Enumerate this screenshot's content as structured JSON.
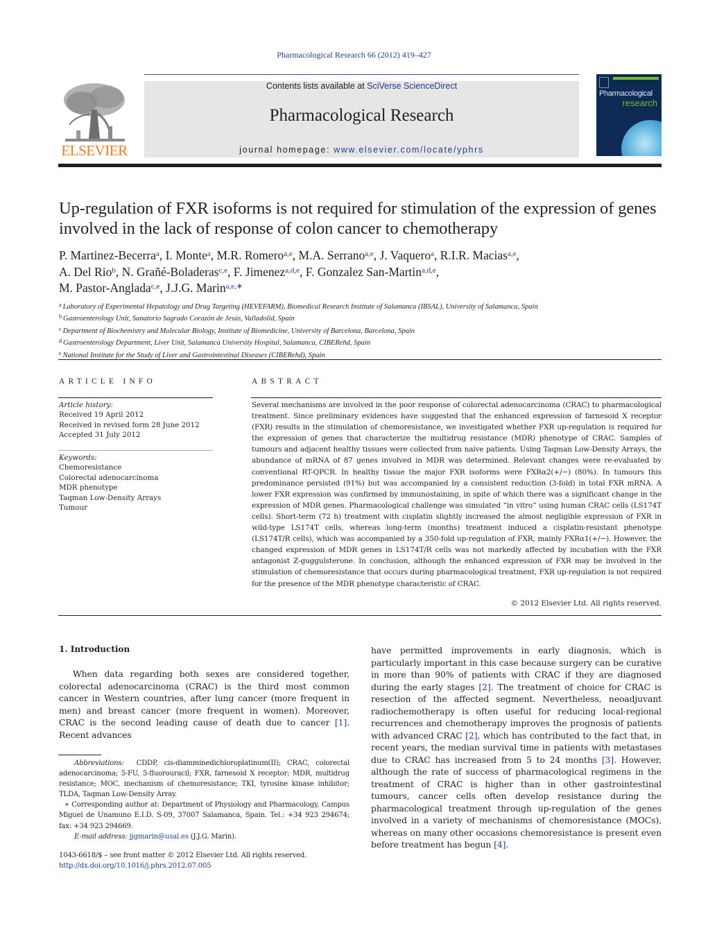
{
  "header": {
    "journal_reference": "Pharmacological Research 66 (2012) 419–427",
    "contents_prefix": "Contents lists available at ",
    "contents_link": "SciVerse ScienceDirect",
    "journal_title": "Pharmacological Research",
    "homepage_prefix": "journal homepage: ",
    "homepage_link": "www.elsevier.com/locate/yphrs",
    "publisher_logo_text": "ELSEVIER",
    "cover_title_line1": "Pharmacological",
    "cover_title_line2": "research",
    "colors": {
      "link": "#1f3f8f",
      "publisher_orange": "#f07c1e",
      "cover_green": "#7ab929",
      "cover_navy": "#0d2a55"
    }
  },
  "article": {
    "title": "Up-regulation of FXR isoforms is not required for stimulation of the expression of genes involved in the lack of response of colon cancer to chemotherapy",
    "authors": [
      {
        "name": "P. Martinez-Becerra",
        "aff": "a"
      },
      {
        "name": "I. Monte",
        "aff": "a"
      },
      {
        "name": "M.R. Romero",
        "aff": "a,e"
      },
      {
        "name": "M.A. Serrano",
        "aff": "a,e"
      },
      {
        "name": "J. Vaquero",
        "aff": "a"
      },
      {
        "name": "R.I.R. Macias",
        "aff": "a,e"
      },
      {
        "name": "A. Del Rio",
        "aff": "b"
      },
      {
        "name": "N. Grañé-Boladeras",
        "aff": "c,e"
      },
      {
        "name": "F. Jimenez",
        "aff": "a,d,e"
      },
      {
        "name": "F. Gonzalez San-Martin",
        "aff": "a,d,e"
      },
      {
        "name": "M. Pastor-Anglada",
        "aff": "c,e"
      },
      {
        "name": "J.J.G. Marin",
        "aff": "a,e,∗"
      }
    ],
    "affiliations": [
      {
        "key": "a",
        "text": "Laboratory of Experimental Hepatology and Drug Targeting (HEVEFARM), Biomedical Research Institute of Salamanca (IBSAL), University of Salamanca, Spain"
      },
      {
        "key": "b",
        "text": "Gastroenterology Unit, Sanatorio Sagrado Corazón de Jesús, Valladolid, Spain"
      },
      {
        "key": "c",
        "text": "Department of Biochemistry and Molecular Biology, Institute of Biomedicine, University of Barcelona, Barcelona, Spain"
      },
      {
        "key": "d",
        "text": "Gastroenterology Department, Liver Unit, Salamanca University Hospital, Salamanca, CIBERehd, Spain"
      },
      {
        "key": "e",
        "text": "National Institute for the Study of Liver and Gastrointestinal Diseases (CIBERehd), Spain"
      }
    ]
  },
  "article_info": {
    "heading": "ARTICLE INFO",
    "history_label": "Article history:",
    "history": [
      "Received 19 April 2012",
      "Received in revised form 28 June 2012",
      "Accepted 31 July 2012"
    ],
    "keywords_label": "Keywords:",
    "keywords": [
      "Chemoresistance",
      "Colorectal adenocarcinoma",
      "MDR phenotype",
      "Taqman Low-Density Arrays",
      "Tumour"
    ]
  },
  "abstract": {
    "heading": "ABSTRACT",
    "text": "Several mechanisms are involved in the poor response of colorectal adenocarcinoma (CRAC) to pharmacological treatment. Since preliminary evidences have suggested that the enhanced expression of farnesoid X receptor (FXR) results in the stimulation of chemoresistance, we investigated whether FXR up-regulation is required for the expression of genes that characterize the multidrug resistance (MDR) phenotype of CRAC. Samples of tumours and adjacent healthy tissues were collected from naive patients. Using Taqman Low-Density Arrays, the abundance of mRNA of 87 genes involved in MDR was determined. Relevant changes were re-evaluated by conventional RT-QPCR. In healthy tissue the major FXR isoforms were FXRα2(+/−) (80%). In tumours this predominance persisted (91%) but was accompanied by a consistent reduction (3-fold) in total FXR mRNA. A lower FXR expression was confirmed by immunostaining, in spite of which there was a significant change in the expression of MDR genes. Pharmacological challenge was simulated “in vitro” using human CRAC cells (LS174T cells). Short-term (72 h) treatment with cisplatin slightly increased the almost negligible expression of FXR in wild-type LS174T cells, whereas long-term (months) treatment induced a cisplatin-resistant phenotype (LS174T/R cells), which was accompanied by a 350-fold up-regulation of FXR, mainly FXRα1(+/−). However, the changed expression of MDR genes in LS174T/R cells was not markedly affected by incubation with the FXR antagonist Z-guggulsterone. In conclusion, although the enhanced expression of FXR may be involved in the stimulation of chemoresistance that occurs during pharmacological treatment, FXR up-regulation is not required for the presence of the MDR phenotype characteristic of CRAC.",
    "copyright": "© 2012 Elsevier Ltd. All rights reserved."
  },
  "body": {
    "section_heading": "1.  Introduction",
    "left_paragraph": [
      {
        "t": "When data regarding both sexes are considered together, colorectal adenocarcinoma (CRAC) is the third most common cancer in Western countries, after lung cancer (more frequent in men) and breast cancer (more frequent in women). Moreover, CRAC is the second leading cause of death due to cancer "
      },
      {
        "ref": "[1]"
      },
      {
        "t": ". Recent advances"
      }
    ],
    "right_paragraph": [
      {
        "t": "have permitted improvements in early diagnosis, which is particularly important in this case because surgery can be curative in more than 90% of patients with CRAC if they are diagnosed during the early stages "
      },
      {
        "ref": "[2]"
      },
      {
        "t": ". The treatment of choice for CRAC is resection of the affected segment. Nevertheless, neoadjuvant radiochemotherapy is often useful for reducing local-regional recurrences and chemotherapy improves the prognosis of patients with advanced CRAC "
      },
      {
        "ref": "[2]"
      },
      {
        "t": ", which has contributed to the fact that, in recent years, the median survival time in patients with metastases due to CRAC has increased from 5 to 24 months "
      },
      {
        "ref": "[3]"
      },
      {
        "t": ". However, although the rate of success of pharmacological regimens in the treatment of CRAC is higher than in other gastrointestinal tumours, cancer cells often develop resistance during the pharmacological treatment through up-regulation of the genes involved in a variety of mechanisms of chemoresistance (MOCs), whereas on many other occasions chemoresistance is present even before treatment has begun "
      },
      {
        "ref": "[4]"
      },
      {
        "t": "."
      }
    ]
  },
  "footnotes": {
    "abbreviations_label": "Abbreviations:",
    "abbreviations_text": "CDDP, cis-diamminedichloroplatinum(II); CRAC, colorectal adenocarcinoma; 5-FU, 5-fluorouracil; FXR, farnesoid X receptor; MDR, multidrug resistance; MOC, mechanism of chemoresistance; TKI, tyrosine kinase inhibitor; TLDA, Taqman Low-Density Array.",
    "corresponding": "∗ Corresponding author at: Department of Physiology and Pharmacology, Campus Miguel de Unamuno E.I.D. S-09, 37007 Salamanca, Spain. Tel.: +34 923 294674; fax: +34 923 294669.",
    "email_label": "E-mail address:",
    "email": "jjgmarin@usal.es",
    "email_suffix": " (J.J.G. Marin).",
    "front_matter": "1043-6618/$ – see front matter © 2012 Elsevier Ltd. All rights reserved.",
    "doi": "http://dx.doi.org/10.1016/j.phrs.2012.07.005"
  }
}
